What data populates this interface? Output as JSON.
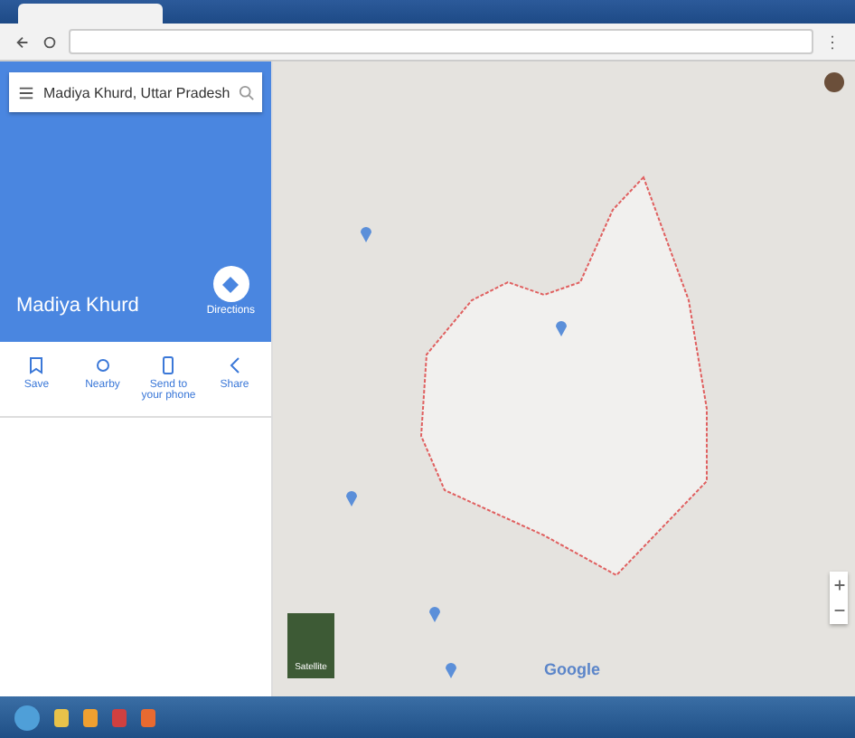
{
  "search": {
    "value": "Madiya Khurd, Uttar Pradesh"
  },
  "place": {
    "name": "Madiya Khurd",
    "directions": "Directions"
  },
  "actions": [
    {
      "kind": "save",
      "label": "Save"
    },
    {
      "kind": "nearby",
      "label": "Nearby"
    },
    {
      "kind": "phone",
      "label": "Send to your phone"
    },
    {
      "kind": "share",
      "label": "Share"
    }
  ],
  "map": {
    "layer_label": "Satellite",
    "logo": "Google"
  }
}
